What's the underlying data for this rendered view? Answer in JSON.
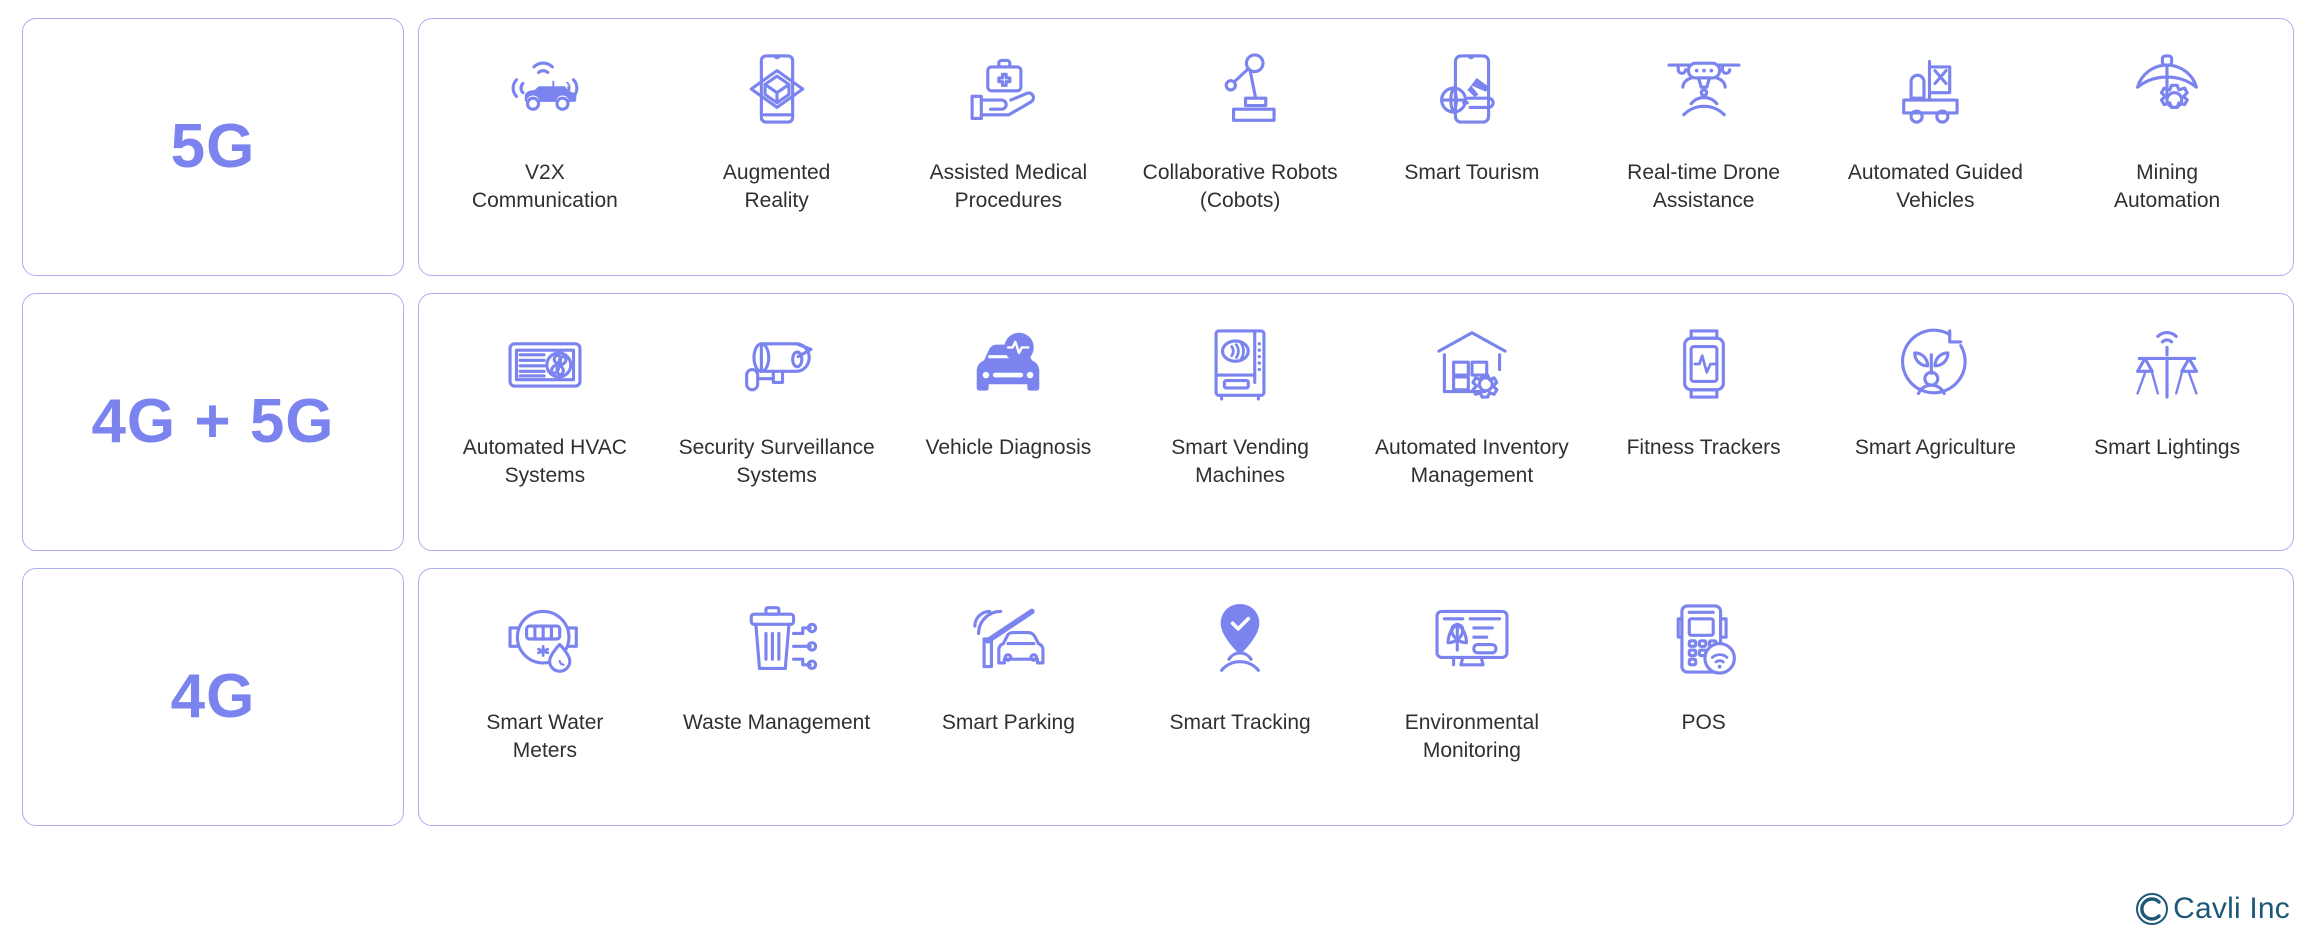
{
  "accent_color": "#7b84ee",
  "border_color": "#aab0f0",
  "label_color": "#2f3033",
  "brand": {
    "name": "Cavli Inc",
    "mark": "circled-c-logo",
    "color": "#1d5878"
  },
  "tiers": [
    {
      "id": "5g",
      "label": "5G",
      "items": [
        {
          "label": "V2X\nCommunication",
          "icon": "connected-car-v2x-icon"
        },
        {
          "label": "Augmented\nReality",
          "icon": "phone-ar-cube-icon"
        },
        {
          "label": "Assisted Medical\nProcedures",
          "icon": "hand-medical-kit-icon"
        },
        {
          "label": "Collaborative Robots\n(Cobots)",
          "icon": "robot-arm-icon"
        },
        {
          "label": "Smart Tourism",
          "icon": "phone-globe-plane-icon"
        },
        {
          "label": "Real-time Drone\nAssistance",
          "icon": "drone-signal-icon"
        },
        {
          "label": "Automated Guided\nVehicles",
          "icon": "forklift-agv-icon"
        },
        {
          "label": "Mining\nAutomation",
          "icon": "pickaxe-gear-icon"
        }
      ]
    },
    {
      "id": "4g-5g",
      "label": "4G + 5G",
      "items": [
        {
          "label": "Automated HVAC\nSystems",
          "icon": "hvac-vent-fan-icon"
        },
        {
          "label": "Security Surveillance\nSystems",
          "icon": "cctv-camera-icon"
        },
        {
          "label": "Vehicle Diagnosis",
          "icon": "car-pulse-diagnostic-icon"
        },
        {
          "label": "Smart Vending\nMachines",
          "icon": "vending-machine-nfc-icon"
        },
        {
          "label": "Automated Inventory\nManagement",
          "icon": "warehouse-gear-icon"
        },
        {
          "label": "Fitness Trackers",
          "icon": "smartwatch-heartbeat-icon"
        },
        {
          "label": "Smart Agriculture",
          "icon": "agriculture-circle-icon"
        },
        {
          "label": "Smart Lightings",
          "icon": "street-lamp-signal-icon"
        }
      ]
    },
    {
      "id": "4g",
      "label": "4G",
      "items": [
        {
          "label": "Smart Water\nMeters",
          "icon": "water-meter-droplet-icon"
        },
        {
          "label": "Waste Management",
          "icon": "trash-bin-network-icon"
        },
        {
          "label": "Smart Parking",
          "icon": "parking-barrier-car-icon"
        },
        {
          "label": "Smart Tracking",
          "icon": "location-pin-signal-icon"
        },
        {
          "label": "Environmental\nMonitoring",
          "icon": "monitor-leaf-icon"
        },
        {
          "label": "POS",
          "icon": "pos-terminal-wifi-icon"
        }
      ]
    }
  ]
}
